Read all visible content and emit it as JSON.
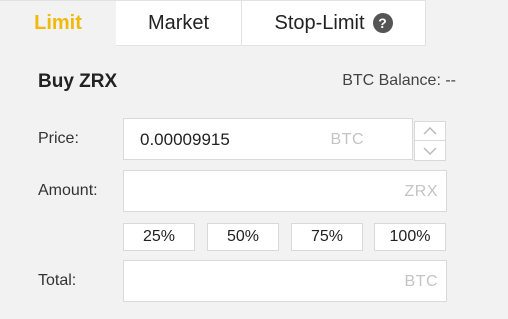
{
  "tabs": [
    {
      "label": "Limit",
      "active": true
    },
    {
      "label": "Market",
      "active": false
    },
    {
      "label": "Stop-Limit",
      "active": false
    }
  ],
  "help_icon_glyph": "?",
  "form": {
    "title": "Buy ZRX",
    "balance_label": "BTC Balance: --",
    "price": {
      "label": "Price:",
      "value": "0.00009915",
      "unit": "BTC"
    },
    "amount": {
      "label": "Amount:",
      "value": "",
      "unit": "ZRX"
    },
    "percent_buttons": [
      "25%",
      "50%",
      "75%",
      "100%"
    ],
    "total": {
      "label": "Total:",
      "value": "",
      "unit": "BTC"
    }
  },
  "stepper": {
    "up_icon": "chevron-up-icon",
    "down_icon": "chevron-down-icon"
  },
  "colors": {
    "accent": "#f0b90b",
    "background": "#f2f2f2"
  }
}
